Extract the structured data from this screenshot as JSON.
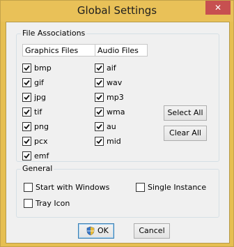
{
  "window": {
    "title": "Global Settings",
    "close_glyph": "✕"
  },
  "file_associations": {
    "title": "File Associations",
    "graphics": {
      "header": "Graphics Files",
      "items": [
        {
          "label": "bmp",
          "checked": true
        },
        {
          "label": "gif",
          "checked": true
        },
        {
          "label": "jpg",
          "checked": true
        },
        {
          "label": "tif",
          "checked": true
        },
        {
          "label": "png",
          "checked": true
        },
        {
          "label": "pcx",
          "checked": true
        },
        {
          "label": "emf",
          "checked": true
        }
      ]
    },
    "audio": {
      "header": "Audio Files",
      "items": [
        {
          "label": "aif",
          "checked": true
        },
        {
          "label": "wav",
          "checked": true
        },
        {
          "label": "mp3",
          "checked": true
        },
        {
          "label": "wma",
          "checked": true
        },
        {
          "label": "au",
          "checked": true
        },
        {
          "label": "mid",
          "checked": true
        }
      ]
    },
    "select_all": "Select All",
    "clear_all": "Clear All"
  },
  "general": {
    "title": "General",
    "start_with_windows": {
      "label": "Start with Windows",
      "checked": false
    },
    "single_instance": {
      "label": "Single Instance",
      "checked": false
    },
    "tray_icon": {
      "label": "Tray Icon",
      "checked": false
    }
  },
  "buttons": {
    "ok": "OK",
    "cancel": "Cancel"
  },
  "icons": {
    "ok_icon": "shield-icon",
    "close_icon": "close-icon"
  },
  "colors": {
    "titlebar": "#e9c158",
    "close": "#c75050",
    "default_button_border": "#3c7fb1"
  }
}
